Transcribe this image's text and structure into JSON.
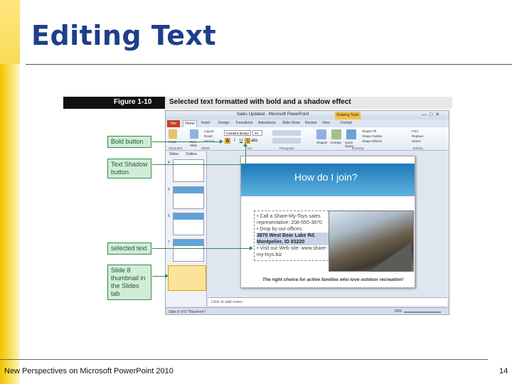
{
  "slide": {
    "title": "Editing Text",
    "footer": "New Perspectives on Microsoft PowerPoint 2010",
    "number": "14"
  },
  "figure": {
    "label": "Figure 1-10",
    "caption": "Selected text formatted with bold and a shadow effect"
  },
  "ppt": {
    "window_title": "Sales Updated - Microsoft PowerPoint",
    "tools_tab": "Drawing Tools",
    "tabs": [
      "File",
      "Home",
      "Insert",
      "Design",
      "Transitions",
      "Animations",
      "Slide Show",
      "Review",
      "View",
      "Format"
    ],
    "ribbon": {
      "paste": "Paste",
      "new_slide": "New Slide",
      "layout": "Layout",
      "reset": "Reset",
      "section": "Section",
      "font_name": "Candara (Body)",
      "font_size": "24",
      "shapes": "Shapes",
      "arrange": "Arrange",
      "quick_styles": "Quick Styles",
      "shape_fill": "Shape Fill",
      "shape_outline": "Shape Outline",
      "shape_effects": "Shape Effects",
      "find": "Find",
      "replace": "Replace",
      "select": "Select",
      "groups": [
        "Clipboard",
        "Slides",
        "Font",
        "Paragraph",
        "Drawing",
        "Editing"
      ]
    },
    "panel_tabs": [
      "Slides",
      "Outline"
    ],
    "thumb_numbers": [
      "4",
      "5",
      "6",
      "7",
      "8"
    ],
    "slide_content": {
      "title": "How do I join?",
      "bullet1": "Call a Share-My-Toys sales representative: 208-555-3870",
      "bullet2_lead": "Drop by our offices:",
      "bullet2_selected": "3870 West Bear Lake Rd. Montpelier, ID 83220",
      "bullet3": "Visit our Web site: www.share-my-toys.biz",
      "tagline": "The right choice for active families who love outdoor recreation!"
    },
    "notes_placeholder": "Click to add notes",
    "status": "Slide 8 of 8   \"Waveform\"",
    "zoom": "69%"
  },
  "callouts": {
    "bold_button": "Bold button",
    "text_shadow": "Text Shadow button",
    "selected_text": "selected text",
    "slide8": "Slide 8 thumbnail in the Slides tab"
  },
  "colors": {
    "title": "#1f3e8a",
    "accent_band": "#f3c400",
    "callout_bg": "#d2ecd8",
    "callout_border": "#2f8e4e",
    "file_tab": "#c5441e"
  }
}
